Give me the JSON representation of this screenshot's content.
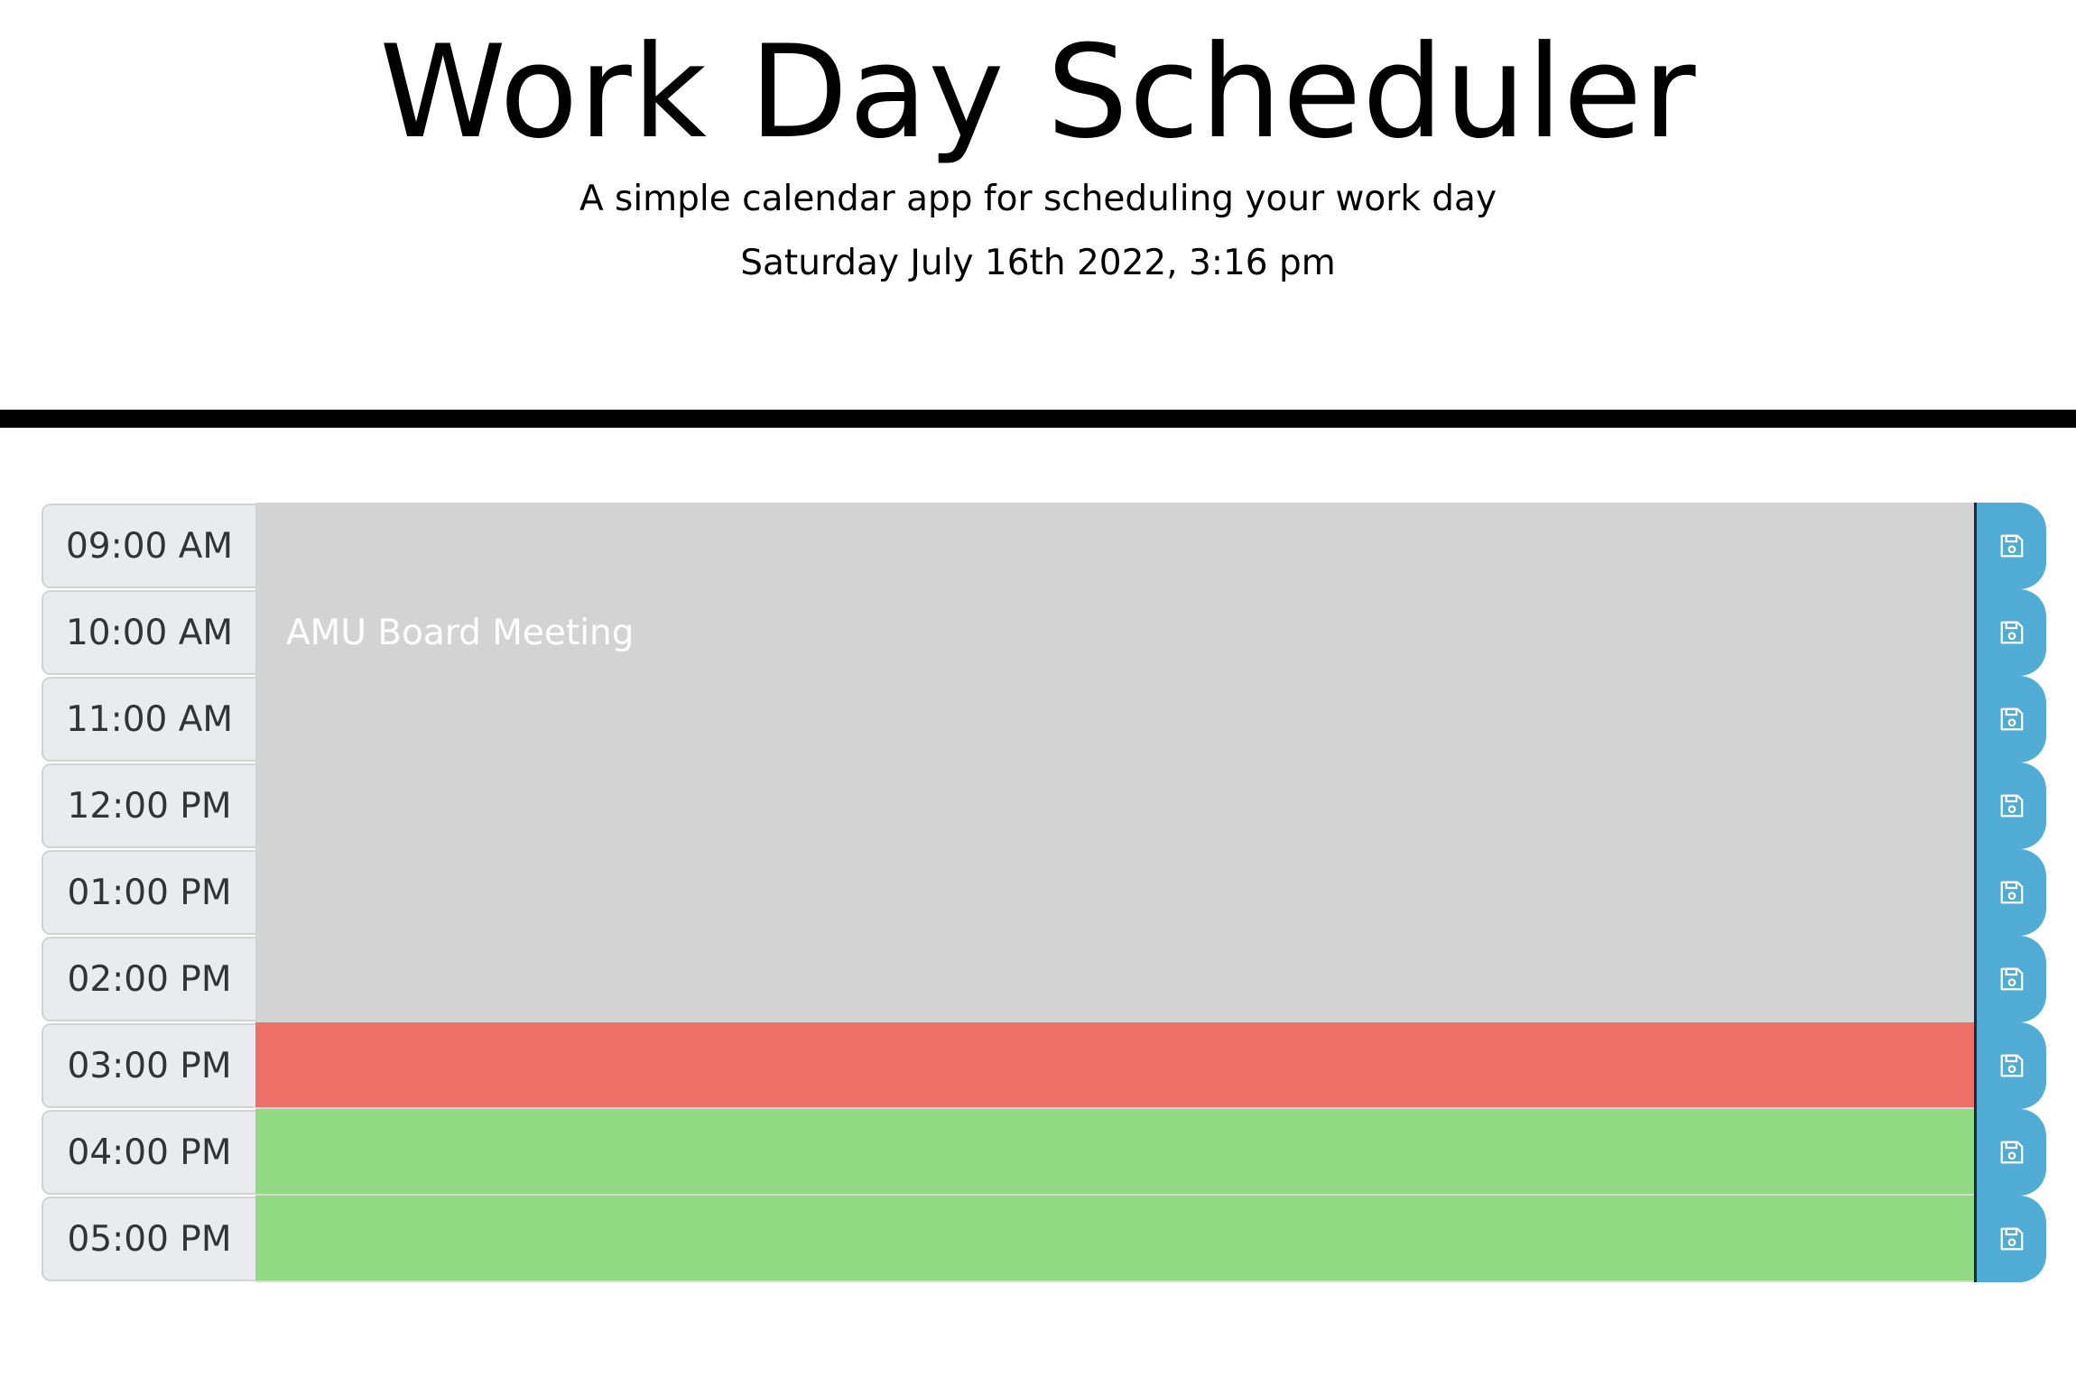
{
  "header": {
    "title": "Work Day Scheduler",
    "lead": "A simple calendar app for scheduling your work day",
    "current_day": "Saturday July 16th 2022, 3:16 pm"
  },
  "colors": {
    "past": "#d3d3d3",
    "present": "#ec7068",
    "future": "#92db84",
    "save_button": "#50acd5"
  },
  "save_icon": "floppy-disk-icon",
  "timeblocks": [
    {
      "hour": "09:00 AM",
      "description": "",
      "status": "past"
    },
    {
      "hour": "10:00 AM",
      "description": "AMU Board Meeting",
      "status": "past"
    },
    {
      "hour": "11:00 AM",
      "description": "",
      "status": "past"
    },
    {
      "hour": "12:00 PM",
      "description": "",
      "status": "past"
    },
    {
      "hour": "01:00 PM",
      "description": "",
      "status": "past"
    },
    {
      "hour": "02:00 PM",
      "description": "",
      "status": "past"
    },
    {
      "hour": "03:00 PM",
      "description": "",
      "status": "present"
    },
    {
      "hour": "04:00 PM",
      "description": "",
      "status": "future"
    },
    {
      "hour": "05:00 PM",
      "description": "",
      "status": "future"
    }
  ]
}
